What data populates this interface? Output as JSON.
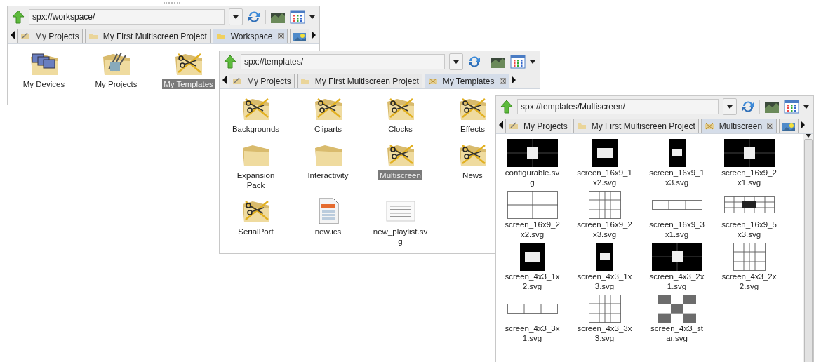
{
  "windows": [
    {
      "address": "spx://workspace/",
      "overflow_tab": true,
      "scrollbar": false,
      "tabs": [
        {
          "label": "My Projects",
          "selected": false,
          "kind": "projects"
        },
        {
          "label": "My First Multiscreen Project",
          "selected": false,
          "kind": "folder"
        },
        {
          "label": "Workspace",
          "selected": true,
          "kind": "workspace"
        }
      ],
      "items": [
        {
          "label": "My Devices",
          "kind": "devices-folder",
          "selected": false
        },
        {
          "label": "My Projects",
          "kind": "projects-folder",
          "selected": false
        },
        {
          "label": "My Templates",
          "kind": "templates-folder",
          "selected": true
        }
      ]
    },
    {
      "address": "spx://templates/",
      "overflow_tab": false,
      "scrollbar": false,
      "tabs": [
        {
          "label": "My Projects",
          "selected": false,
          "kind": "projects"
        },
        {
          "label": "My First Multiscreen Project",
          "selected": false,
          "kind": "folder"
        },
        {
          "label": "My Templates",
          "selected": true,
          "kind": "templates"
        }
      ],
      "items": [
        {
          "label": "Backgrounds",
          "kind": "templates-folder",
          "selected": false
        },
        {
          "label": "Cliparts",
          "kind": "templates-folder",
          "selected": false
        },
        {
          "label": "Clocks",
          "kind": "templates-folder",
          "selected": false
        },
        {
          "label": "Effects",
          "kind": "templates-folder",
          "selected": false
        },
        {
          "label": "Expansion Pack",
          "kind": "folder",
          "selected": false
        },
        {
          "label": "Interactivity",
          "kind": "folder",
          "selected": false
        },
        {
          "label": "Multiscreen",
          "kind": "templates-folder",
          "selected": true
        },
        {
          "label": "News",
          "kind": "templates-folder",
          "selected": false
        },
        {
          "label": "SerialPort",
          "kind": "templates-folder",
          "selected": false
        },
        {
          "label": "new.ics",
          "kind": "calendar-file",
          "selected": false
        },
        {
          "label": "new_playlist.svg",
          "kind": "document-file",
          "selected": false
        }
      ]
    },
    {
      "address": "spx://templates/Multiscreen/",
      "overflow_tab": true,
      "scrollbar": true,
      "tabs": [
        {
          "label": "My Projects",
          "selected": false,
          "kind": "projects"
        },
        {
          "label": "My First Multiscreen Project",
          "selected": false,
          "kind": "folder"
        },
        {
          "label": "Multiscreen",
          "selected": true,
          "kind": "templates"
        }
      ],
      "items": [
        {
          "label": "configurable.svg",
          "kind": "dark-wide",
          "selected": false
        },
        {
          "label": "screen_16x9_1x2.svg",
          "kind": "dark-square",
          "selected": false
        },
        {
          "label": "screen_16x9_1x3.svg",
          "kind": "dark-tall",
          "selected": false
        },
        {
          "label": "screen_16x9_2x1.svg",
          "kind": "dark-wide",
          "selected": false
        },
        {
          "label": "screen_16x9_2x2.svg",
          "kind": "light-wide",
          "selected": false
        },
        {
          "label": "screen_16x9_2x3.svg",
          "kind": "light-square",
          "selected": false
        },
        {
          "label": "screen_16x9_3x1.svg",
          "kind": "light-strip",
          "selected": false
        },
        {
          "label": "screen_16x9_5x3.svg",
          "kind": "light-grid",
          "selected": false
        },
        {
          "label": "screen_4x3_1x2.svg",
          "kind": "dark-square",
          "selected": false
        },
        {
          "label": "screen_4x3_1x3.svg",
          "kind": "dark-tall",
          "selected": false
        },
        {
          "label": "screen_4x3_2x1.svg",
          "kind": "dark-wide",
          "selected": false
        },
        {
          "label": "screen_4x3_2x2.svg",
          "kind": "light-square",
          "selected": false
        },
        {
          "label": "screen_4x3_3x1.svg",
          "kind": "light-strip",
          "selected": false
        },
        {
          "label": "screen_4x3_3x3.svg",
          "kind": "light-square",
          "selected": false
        },
        {
          "label": "screen_4x3_star.svg",
          "kind": "checker",
          "selected": false
        }
      ]
    }
  ]
}
